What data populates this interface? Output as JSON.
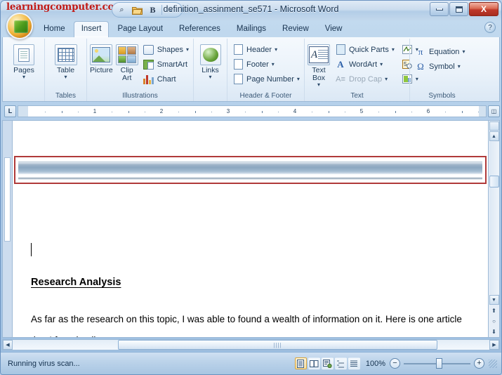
{
  "window": {
    "brand": "learningcomputer.com",
    "title": "definition_assinment_se571 - Microsoft Word",
    "minimize_label": "Minimize",
    "maximize_label": "Maximize",
    "close_label": "X"
  },
  "quick_access": {
    "items": [
      {
        "name": "print-preview-icon",
        "glyph": "⌕"
      },
      {
        "name": "open-icon",
        "glyph": "🗁"
      },
      {
        "name": "bold-icon",
        "glyph": "B"
      },
      {
        "name": "customize-icon",
        "glyph": "▾"
      }
    ]
  },
  "tabs": [
    {
      "label": "Home",
      "active": false
    },
    {
      "label": "Insert",
      "active": true
    },
    {
      "label": "Page Layout",
      "active": false
    },
    {
      "label": "References",
      "active": false
    },
    {
      "label": "Mailings",
      "active": false
    },
    {
      "label": "Review",
      "active": false
    },
    {
      "label": "View",
      "active": false
    }
  ],
  "help_button": "?",
  "ribbon": {
    "groups": [
      {
        "label": "",
        "name": "pages",
        "big": [
          {
            "label": "Pages",
            "caret": "▾"
          }
        ]
      },
      {
        "label": "Tables",
        "name": "tables",
        "big": [
          {
            "label": "Table",
            "caret": "▾"
          }
        ]
      },
      {
        "label": "Illustrations",
        "name": "illustrations",
        "big": [
          {
            "label": "Picture",
            "caret": ""
          },
          {
            "label": "Clip\nArt",
            "caret": ""
          }
        ],
        "small": [
          {
            "label": "Shapes",
            "caret": "▾",
            "disabled": false
          },
          {
            "label": "SmartArt",
            "caret": "",
            "disabled": false
          },
          {
            "label": "Chart",
            "caret": "",
            "disabled": false
          }
        ]
      },
      {
        "label": "",
        "name": "links",
        "big": [
          {
            "label": "Links",
            "caret": "▾"
          }
        ]
      },
      {
        "label": "Header & Footer",
        "name": "header-footer",
        "small": [
          {
            "label": "Header",
            "caret": "▾",
            "disabled": false
          },
          {
            "label": "Footer",
            "caret": "▾",
            "disabled": false
          },
          {
            "label": "Page Number",
            "caret": "▾",
            "disabled": false
          }
        ]
      },
      {
        "label": "Text",
        "name": "text",
        "big": [
          {
            "label": "Text\nBox",
            "caret": "▾"
          }
        ],
        "small": [
          {
            "label": "Quick Parts",
            "caret": "▾",
            "disabled": false
          },
          {
            "label": "WordArt",
            "caret": "▾",
            "disabled": false
          },
          {
            "label": "Drop Cap",
            "caret": "▾",
            "disabled": true
          }
        ],
        "extra": [
          {
            "name": "signature-line-icon",
            "caret": "▾"
          },
          {
            "name": "date-time-icon",
            "caret": ""
          },
          {
            "name": "object-icon",
            "caret": "▾"
          }
        ]
      },
      {
        "label": "Symbols",
        "name": "symbols",
        "small": [
          {
            "label": "Equation",
            "caret": "▾",
            "disabled": false
          },
          {
            "label": "Symbol",
            "caret": "▾",
            "disabled": false
          }
        ]
      }
    ]
  },
  "ruler": {
    "tab_selector": "L",
    "numbers": [
      "1",
      "2",
      "3",
      "4",
      "5",
      "6"
    ]
  },
  "document": {
    "caret_visible": true,
    "heading": "Research Analysis",
    "paragraph": "As far as the research on this topic, I was able to found a wealth of information on it. Here is one article that I found online:",
    "annotation": {
      "name": "red-highlight-box",
      "color": "#b03a3a"
    },
    "banner": {
      "name": "header-banner-graphic"
    }
  },
  "scrollbars": {
    "v_up": "▲",
    "v_down": "▼",
    "h_left": "◀",
    "h_right": "▶",
    "prev_object": "⬆",
    "select_object": "○",
    "next_object": "⬇",
    "split": "≡"
  },
  "statusbar": {
    "message": "Running virus scan...",
    "views": [
      {
        "name": "print-layout-view",
        "active": true
      },
      {
        "name": "full-screen-reading-view",
        "active": false
      },
      {
        "name": "web-layout-view",
        "active": false
      },
      {
        "name": "outline-view",
        "active": false
      },
      {
        "name": "draft-view",
        "active": false
      }
    ],
    "zoom_level": "100%",
    "zoom_out": "−",
    "zoom_in": "+"
  }
}
